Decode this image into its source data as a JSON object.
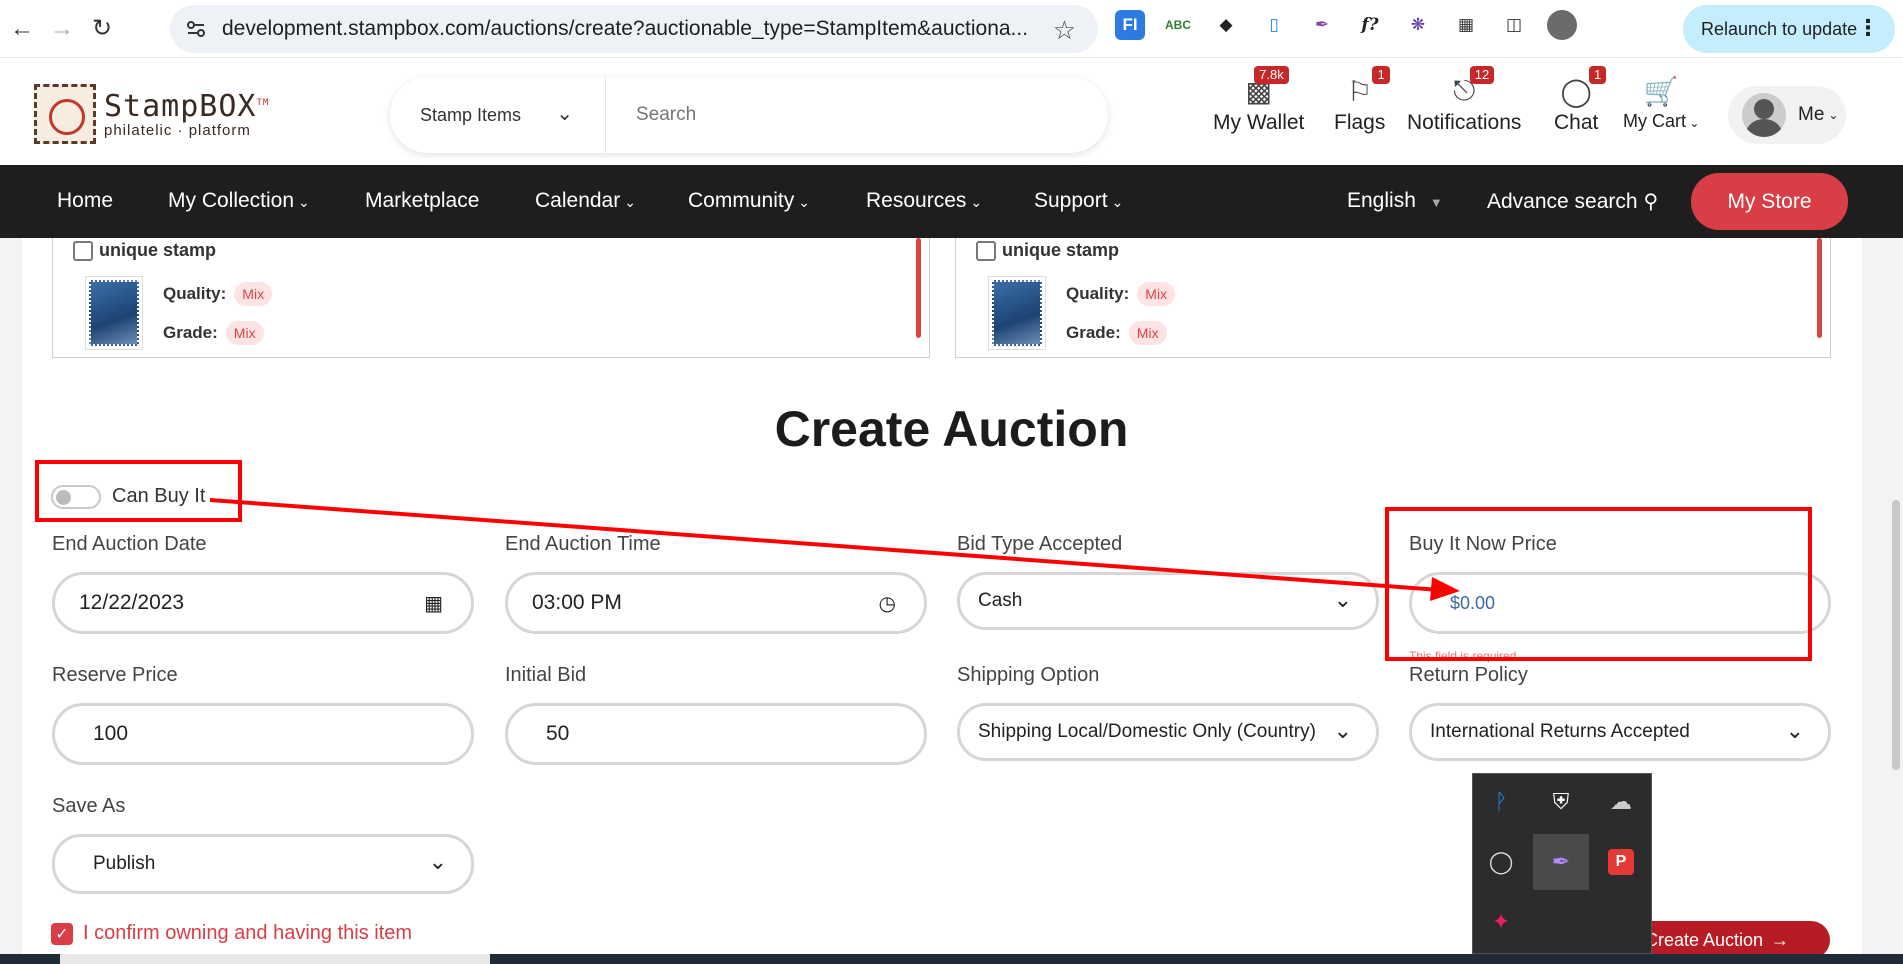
{
  "browser": {
    "url": "development.stampbox.com/auctions/create?auctionable_type=StampItem&auctiona...",
    "relaunch_label": "Relaunch to update",
    "extensions": [
      "fi-extension-icon",
      "spellcheck-extension-icon",
      "spy-extension-icon",
      "phone-extension-icon",
      "feather-extension-icon",
      "formula-extension-icon",
      "snowflake-extension-icon",
      "puzzle-extension-icon"
    ]
  },
  "header": {
    "logo_title": "StampBOX",
    "logo_tm": "TM",
    "logo_subtitle": "philatelic · platform",
    "search_category": "Stamp Items",
    "search_placeholder": "Search",
    "wallet": {
      "label": "My Wallet",
      "badge": "7.8k"
    },
    "flags": {
      "label": "Flags",
      "badge": "1"
    },
    "notifications": {
      "label": "Notifications",
      "badge": "12"
    },
    "chat": {
      "label": "Chat",
      "badge": "1"
    },
    "cart": {
      "label": "My Cart"
    },
    "user": {
      "label": "Me"
    }
  },
  "nav": {
    "items": [
      "Home",
      "My Collection",
      "Marketplace",
      "Calendar",
      "Community",
      "Resources",
      "Support"
    ],
    "language": "English",
    "advance_search": "Advance search",
    "my_store": "My Store"
  },
  "stamp_cards": [
    {
      "title": "unique stamp",
      "quality_label": "Quality:",
      "quality": "Mix",
      "grade_label": "Grade:",
      "grade": "Mix"
    },
    {
      "title": "unique stamp",
      "quality_label": "Quality:",
      "quality": "Mix",
      "grade_label": "Grade:",
      "grade": "Mix"
    }
  ],
  "form": {
    "title": "Create Auction",
    "can_buy_it": "Can Buy It",
    "end_date_label": "End Auction Date",
    "end_date": "12/22/2023",
    "end_time_label": "End Auction Time",
    "end_time": "03:00 PM",
    "bid_type_label": "Bid Type Accepted",
    "bid_type": "Cash",
    "buy_now_label": "Buy It Now Price",
    "buy_now_placeholder": "$0.00",
    "buy_now_error": "This field is required",
    "reserve_label": "Reserve Price",
    "reserve": "100",
    "initial_bid_label": "Initial Bid",
    "initial_bid": "50",
    "shipping_label": "Shipping Option",
    "shipping": "Shipping Local/Domestic Only (Country)",
    "return_label": "Return Policy",
    "return_policy": "International Returns Accepted",
    "save_as_label": "Save As",
    "save_as": "Publish",
    "confirm": "I confirm owning and having this item",
    "submit": "Create Auction"
  },
  "colors": {
    "brand_red": "#d93d45",
    "nav_dark": "#1e1e1e",
    "annotation": "#ff0000"
  }
}
